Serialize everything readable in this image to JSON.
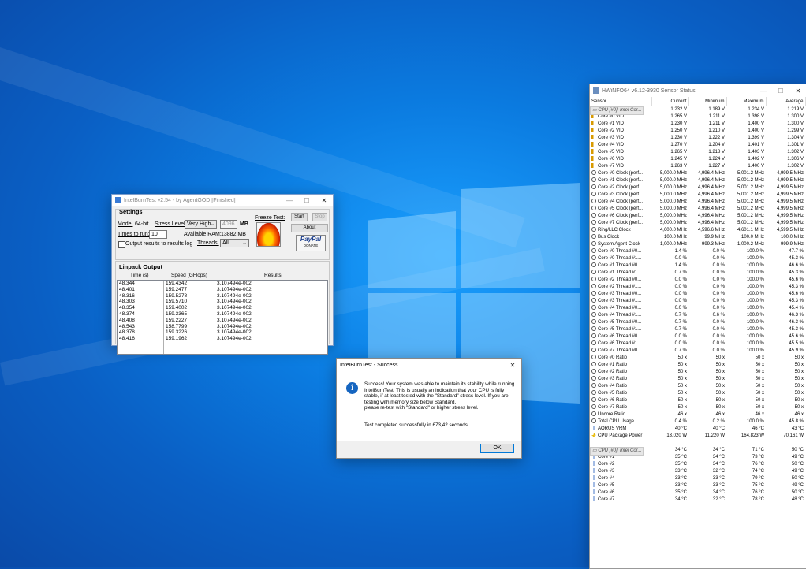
{
  "ibt": {
    "title": "IntelBurnTest v2.54 - by AgentGOD [Finished]",
    "settings_label": "Settings",
    "mode_label": "Mode:",
    "mode_value": "64-bit",
    "stress_label": "Stress Level:",
    "stress_value": "Very High",
    "mem_value": "4096",
    "mem_unit": "MB",
    "times_label": "Times to run:",
    "times_value": "10",
    "avail_label": "Available RAM:",
    "avail_value": "13882 MB",
    "threads_label": "Threads:",
    "threads_value": "All",
    "log_label": "Output results to results log",
    "freeze_label": "Freeze Test:",
    "start_label": "Start",
    "stop_label": "Stop",
    "about_label": "About",
    "paypal_label": "PayPal",
    "donate_label": "DONATE",
    "linpack_label": "Linpack Output",
    "col_time": "Time (s)",
    "col_speed": "Speed (GFlops)",
    "col_results": "Results",
    "times": [
      "48.344",
      "48.401",
      "48.316",
      "48.303",
      "48.354",
      "48.374",
      "48.408",
      "48.543",
      "48.378",
      "48.416"
    ],
    "speeds": [
      "159.4342",
      "159.2477",
      "159.5278",
      "159.5710",
      "159.4002",
      "159.3365",
      "159.2227",
      "158.7799",
      "159.3226",
      "159.1962"
    ],
    "results": [
      "3.107494e-002",
      "3.107494e-002",
      "3.107494e-002",
      "3.107494e-002",
      "3.107494e-002",
      "3.107494e-002",
      "3.107494e-002",
      "3.107494e-002",
      "3.107494e-002",
      "3.107494e-002"
    ]
  },
  "dialog": {
    "title": "IntelBurnTest - Success",
    "message": "Success! Your system was able to maintain its stability while running IntelBurnTest. This is usually an indication that your CPU is fully stable, if at least tested with the \"Standard\" stress level. If you are testing with memory size below Standard,\nplease re-test with \"Standard\" or higher stress level.",
    "completed": "Test completed successfully in 673,42 seconds.",
    "ok_label": "OK",
    "info_icon": "i"
  },
  "hwinfo": {
    "title": "HWiNFO64 v6.12-3930 Sensor Status",
    "headers": [
      "Sensor",
      "Current",
      "Minimum",
      "Maximum",
      "Average"
    ],
    "rows": [
      {
        "type": "group",
        "name": "CPU [#0]: Intel Cor..."
      },
      {
        "i": "v",
        "c": [
          "Vcore",
          "1.232 V",
          "1.189 V",
          "1.234 V",
          "1.219 V"
        ]
      },
      {
        "i": "v",
        "c": [
          "Core #0 VID",
          "1.265 V",
          "1.211 V",
          "1.398 V",
          "1.300 V"
        ]
      },
      {
        "i": "v",
        "c": [
          "Core #1 VID",
          "1.230 V",
          "1.211 V",
          "1.400 V",
          "1.300 V"
        ]
      },
      {
        "i": "v",
        "c": [
          "Core #2 VID",
          "1.250 V",
          "1.210 V",
          "1.400 V",
          "1.299 V"
        ]
      },
      {
        "i": "v",
        "c": [
          "Core #3 VID",
          "1.230 V",
          "1.222 V",
          "1.399 V",
          "1.304 V"
        ]
      },
      {
        "i": "v",
        "c": [
          "Core #4 VID",
          "1.270 V",
          "1.204 V",
          "1.401 V",
          "1.301 V"
        ]
      },
      {
        "i": "v",
        "c": [
          "Core #5 VID",
          "1.265 V",
          "1.218 V",
          "1.403 V",
          "1.302 V"
        ]
      },
      {
        "i": "v",
        "c": [
          "Core #6 VID",
          "1.245 V",
          "1.224 V",
          "1.402 V",
          "1.306 V"
        ]
      },
      {
        "i": "v",
        "c": [
          "Core #7 VID",
          "1.263 V",
          "1.227 V",
          "1.400 V",
          "1.302 V"
        ]
      },
      {
        "i": "c",
        "c": [
          "Core #0 Clock (perf...",
          "5,000.0 MHz",
          "4,996.4 MHz",
          "5,001.2 MHz",
          "4,999.5 MHz"
        ]
      },
      {
        "i": "c",
        "c": [
          "Core #1 Clock (perf...",
          "5,000.0 MHz",
          "4,996.4 MHz",
          "5,001.2 MHz",
          "4,999.5 MHz"
        ]
      },
      {
        "i": "c",
        "c": [
          "Core #2 Clock (perf...",
          "5,000.0 MHz",
          "4,996.4 MHz",
          "5,001.2 MHz",
          "4,999.5 MHz"
        ]
      },
      {
        "i": "c",
        "c": [
          "Core #3 Clock (perf...",
          "5,000.0 MHz",
          "4,996.4 MHz",
          "5,001.2 MHz",
          "4,999.5 MHz"
        ]
      },
      {
        "i": "c",
        "c": [
          "Core #4 Clock (perf...",
          "5,000.0 MHz",
          "4,996.4 MHz",
          "5,001.2 MHz",
          "4,999.5 MHz"
        ]
      },
      {
        "i": "c",
        "c": [
          "Core #5 Clock (perf...",
          "5,000.0 MHz",
          "4,996.4 MHz",
          "5,001.2 MHz",
          "4,999.5 MHz"
        ]
      },
      {
        "i": "c",
        "c": [
          "Core #6 Clock (perf...",
          "5,000.0 MHz",
          "4,996.4 MHz",
          "5,001.2 MHz",
          "4,999.5 MHz"
        ]
      },
      {
        "i": "c",
        "c": [
          "Core #7 Clock (perf...",
          "5,000.0 MHz",
          "4,996.4 MHz",
          "5,001.2 MHz",
          "4,999.5 MHz"
        ]
      },
      {
        "i": "c",
        "c": [
          "Ring/LLC Clock",
          "4,600.0 MHz",
          "4,596.6 MHz",
          "4,601.1 MHz",
          "4,599.5 MHz"
        ]
      },
      {
        "i": "c",
        "c": [
          "Bus Clock",
          "100.0 MHz",
          "99.9 MHz",
          "100.0 MHz",
          "100.0 MHz"
        ]
      },
      {
        "i": "c",
        "c": [
          "System Agent Clock",
          "1,000.0 MHz",
          "999.3 MHz",
          "1,000.2 MHz",
          "999.9 MHz"
        ]
      },
      {
        "i": "c",
        "c": [
          "Core #0 Thread #0...",
          "1.4 %",
          "0.0 %",
          "100.0 %",
          "47.7 %"
        ]
      },
      {
        "i": "c",
        "c": [
          "Core #0 Thread #1...",
          "0.0 %",
          "0.0 %",
          "100.0 %",
          "45.3 %"
        ]
      },
      {
        "i": "c",
        "c": [
          "Core #1 Thread #0...",
          "1.4 %",
          "0.0 %",
          "100.0 %",
          "46.6 %"
        ]
      },
      {
        "i": "c",
        "c": [
          "Core #1 Thread #1...",
          "0.7 %",
          "0.0 %",
          "100.0 %",
          "45.3 %"
        ]
      },
      {
        "i": "c",
        "c": [
          "Core #2 Thread #0...",
          "0.0 %",
          "0.0 %",
          "100.0 %",
          "45.6 %"
        ]
      },
      {
        "i": "c",
        "c": [
          "Core #2 Thread #1...",
          "0.0 %",
          "0.0 %",
          "100.0 %",
          "45.3 %"
        ]
      },
      {
        "i": "c",
        "c": [
          "Core #3 Thread #0...",
          "0.0 %",
          "0.0 %",
          "100.0 %",
          "45.6 %"
        ]
      },
      {
        "i": "c",
        "c": [
          "Core #3 Thread #1...",
          "0.0 %",
          "0.0 %",
          "100.0 %",
          "45.3 %"
        ]
      },
      {
        "i": "c",
        "c": [
          "Core #4 Thread #0...",
          "0.0 %",
          "0.0 %",
          "100.0 %",
          "45.4 %"
        ]
      },
      {
        "i": "c",
        "c": [
          "Core #4 Thread #1...",
          "0.7 %",
          "0.6 %",
          "100.0 %",
          "46.3 %"
        ]
      },
      {
        "i": "c",
        "c": [
          "Core #5 Thread #0...",
          "0.7 %",
          "0.0 %",
          "100.0 %",
          "46.3 %"
        ]
      },
      {
        "i": "c",
        "c": [
          "Core #5 Thread #1...",
          "0.7 %",
          "0.0 %",
          "100.0 %",
          "45.3 %"
        ]
      },
      {
        "i": "c",
        "c": [
          "Core #6 Thread #0...",
          "0.0 %",
          "0.0 %",
          "100.0 %",
          "45.6 %"
        ]
      },
      {
        "i": "c",
        "c": [
          "Core #6 Thread #1...",
          "0.0 %",
          "0.0 %",
          "100.0 %",
          "45.5 %"
        ]
      },
      {
        "i": "c",
        "c": [
          "Core #7 Thread #0...",
          "0.7 %",
          "0.0 %",
          "100.0 %",
          "45.9 %"
        ]
      },
      {
        "i": "c",
        "c": [
          "Core #0 Ratio",
          "50 x",
          "50 x",
          "50 x",
          "50 x"
        ]
      },
      {
        "i": "c",
        "c": [
          "Core #1 Ratio",
          "50 x",
          "50 x",
          "50 x",
          "50 x"
        ]
      },
      {
        "i": "c",
        "c": [
          "Core #2 Ratio",
          "50 x",
          "50 x",
          "50 x",
          "50 x"
        ]
      },
      {
        "i": "c",
        "c": [
          "Core #3 Ratio",
          "50 x",
          "50 x",
          "50 x",
          "50 x"
        ]
      },
      {
        "i": "c",
        "c": [
          "Core #4 Ratio",
          "50 x",
          "50 x",
          "50 x",
          "50 x"
        ]
      },
      {
        "i": "c",
        "c": [
          "Core #5 Ratio",
          "50 x",
          "50 x",
          "50 x",
          "50 x"
        ]
      },
      {
        "i": "c",
        "c": [
          "Core #6 Ratio",
          "50 x",
          "50 x",
          "50 x",
          "50 x"
        ]
      },
      {
        "i": "c",
        "c": [
          "Core #7 Ratio",
          "50 x",
          "50 x",
          "50 x",
          "50 x"
        ]
      },
      {
        "i": "c",
        "c": [
          "Uncore Ratio",
          "46 x",
          "46 x",
          "46 x",
          "46 x"
        ]
      },
      {
        "i": "c",
        "c": [
          "Total CPU Usage",
          "0.4 %",
          "0.2 %",
          "100.0 %",
          "45.8 %"
        ]
      },
      {
        "i": "t",
        "c": [
          "AORUS VRM",
          "40 °C",
          "40 °C",
          "46 °C",
          "43 °C"
        ]
      },
      {
        "i": "p",
        "c": [
          "CPU Package Power",
          "13.020 W",
          "11.220 W",
          "164.823 W",
          "70.161 W"
        ]
      },
      {
        "type": "gap"
      },
      {
        "type": "group",
        "name": "CPU [#0]: Intel Cor..."
      },
      {
        "i": "t",
        "c": [
          "Core #0",
          "34 °C",
          "34 °C",
          "71 °C",
          "50 °C"
        ]
      },
      {
        "i": "t",
        "c": [
          "Core #1",
          "35 °C",
          "34 °C",
          "73 °C",
          "49 °C"
        ]
      },
      {
        "i": "t",
        "c": [
          "Core #2",
          "35 °C",
          "34 °C",
          "76 °C",
          "50 °C"
        ]
      },
      {
        "i": "t",
        "c": [
          "Core #3",
          "33 °C",
          "32 °C",
          "74 °C",
          "49 °C"
        ]
      },
      {
        "i": "t",
        "c": [
          "Core #4",
          "33 °C",
          "33 °C",
          "79 °C",
          "50 °C"
        ]
      },
      {
        "i": "t",
        "c": [
          "Core #5",
          "33 °C",
          "33 °C",
          "75 °C",
          "49 °C"
        ]
      },
      {
        "i": "t",
        "c": [
          "Core #6",
          "35 °C",
          "34 °C",
          "76 °C",
          "50 °C"
        ]
      },
      {
        "i": "t",
        "c": [
          "Core #7",
          "34 °C",
          "32 °C",
          "78 °C",
          "48 °C"
        ]
      }
    ]
  }
}
